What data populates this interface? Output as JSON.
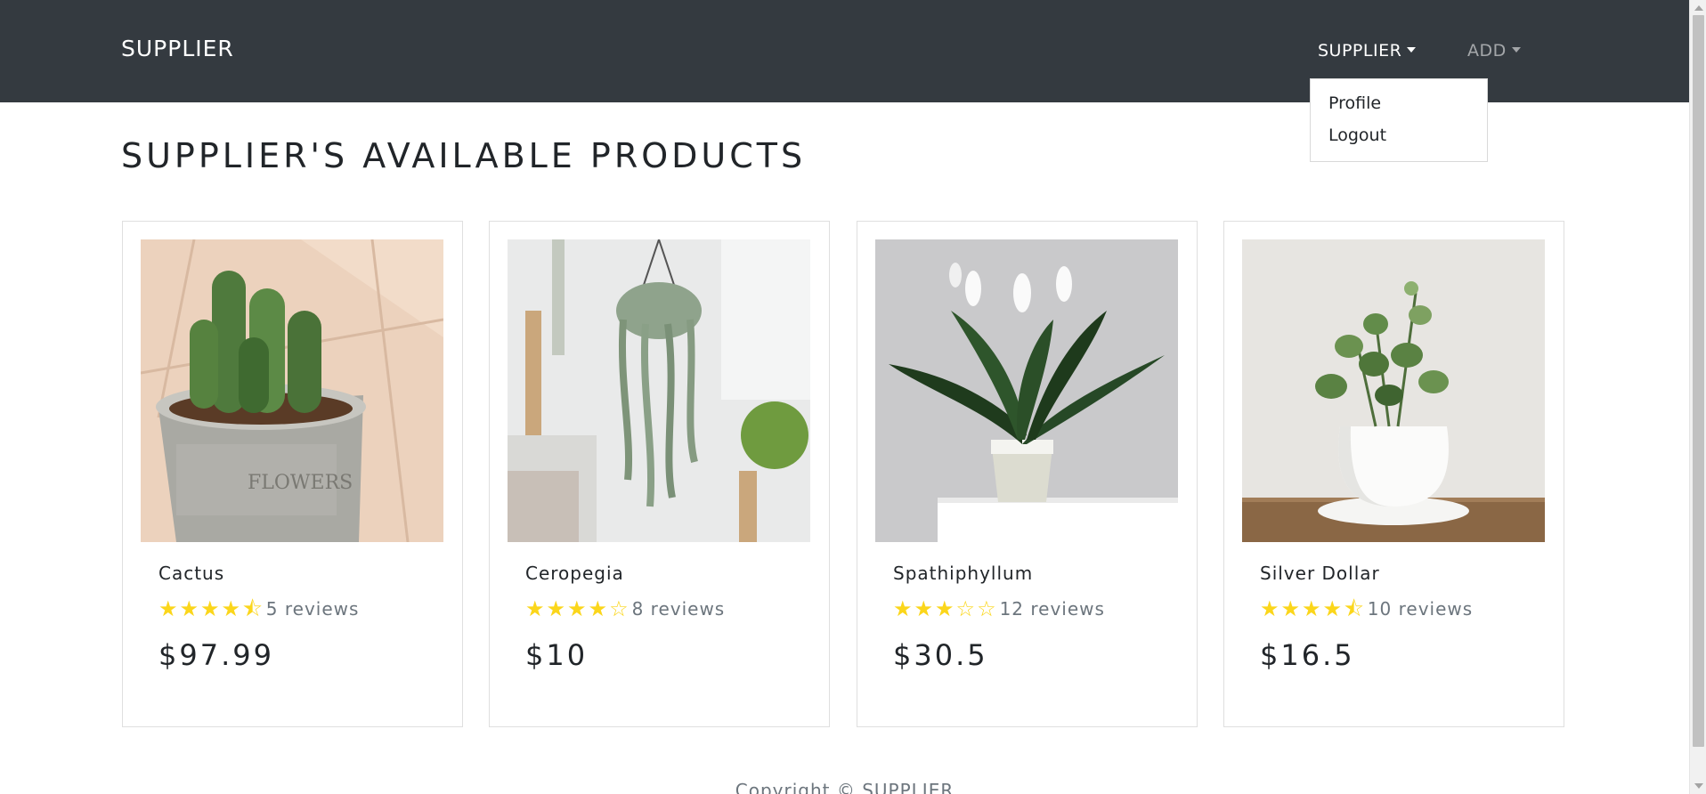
{
  "navbar": {
    "brand": "SUPPLIER",
    "menu": [
      {
        "label": "SUPPLIER",
        "active": true
      },
      {
        "label": "ADD",
        "active": false
      }
    ],
    "dropdown": {
      "items": [
        "Profile",
        "Logout"
      ]
    }
  },
  "page": {
    "title": "SUPPLIER'S AVAILABLE PRODUCTS"
  },
  "products": [
    {
      "name": "Cactus",
      "rating": 4.5,
      "reviews": "5 reviews",
      "price": "$97.99",
      "image_icon": "cactus-photo"
    },
    {
      "name": "Ceropegia",
      "rating": 4,
      "reviews": "8 reviews",
      "price": "$10",
      "image_icon": "hanging-plant-photo"
    },
    {
      "name": "Spathiphyllum",
      "rating": 3,
      "reviews": "12 reviews",
      "price": "$30.5",
      "image_icon": "peace-lily-photo"
    },
    {
      "name": "Silver Dollar",
      "rating": 4.5,
      "reviews": "10 reviews",
      "price": "$16.5",
      "image_icon": "silver-dollar-plant-photo"
    }
  ],
  "footer": {
    "text": "Copyright © SUPPLIER"
  },
  "colors": {
    "navbar_bg": "#343a40",
    "star": "#fbd61b",
    "muted_text": "#6c757d"
  }
}
